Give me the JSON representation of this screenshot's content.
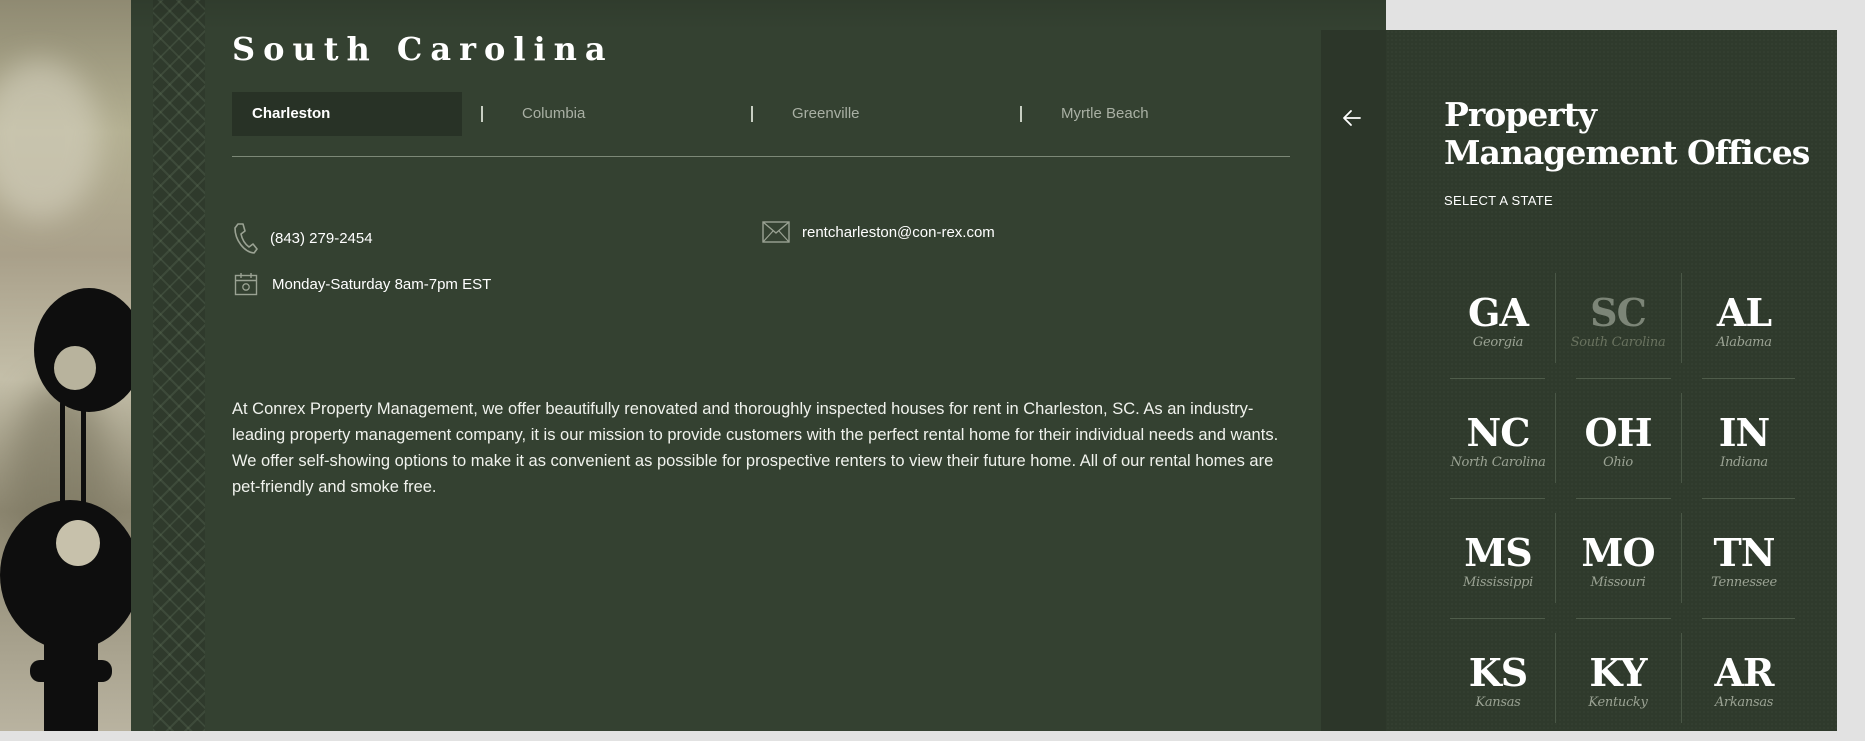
{
  "state": {
    "title": "South Carolina",
    "tabs": [
      {
        "label": "Charleston",
        "active": true
      },
      {
        "label": "Columbia",
        "active": false
      },
      {
        "label": "Greenville",
        "active": false
      },
      {
        "label": "Myrtle Beach",
        "active": false
      }
    ],
    "separator": "|"
  },
  "contact": {
    "phone": "(843) 279-2454",
    "hours": "Monday-Saturday 8am-7pm EST",
    "email": "rentcharleston@con-rex.com"
  },
  "description": "At Conrex Property Management, we offer beautifully renovated and thoroughly inspected houses for rent in Charleston, SC. As an industry-leading property management company, it is our mission to provide customers with the perfect rental home for their individual needs and wants. We offer self-showing options to make it as convenient as possible for prospective renters to view their future home. All of our rental homes are pet-friendly and smoke free.",
  "sidebar": {
    "title_line1": "Property",
    "title_line2": "Management Offices",
    "subtitle": "SELECT A STATE",
    "states": [
      {
        "abbr": "GA",
        "name": "Georgia",
        "selected": false
      },
      {
        "abbr": "SC",
        "name": "South Carolina",
        "selected": true
      },
      {
        "abbr": "AL",
        "name": "Alabama",
        "selected": false
      },
      {
        "abbr": "NC",
        "name": "North Carolina",
        "selected": false
      },
      {
        "abbr": "OH",
        "name": "Ohio",
        "selected": false
      },
      {
        "abbr": "IN",
        "name": "Indiana",
        "selected": false
      },
      {
        "abbr": "MS",
        "name": "Mississippi",
        "selected": false
      },
      {
        "abbr": "MO",
        "name": "Missouri",
        "selected": false
      },
      {
        "abbr": "TN",
        "name": "Tennessee",
        "selected": false
      },
      {
        "abbr": "KS",
        "name": "Kansas",
        "selected": false
      },
      {
        "abbr": "KY",
        "name": "Kentucky",
        "selected": false
      },
      {
        "abbr": "AR",
        "name": "Arkansas",
        "selected": false
      }
    ]
  },
  "icons": {
    "phone": "phone-icon",
    "calendar": "calendar-icon",
    "email": "envelope-icon",
    "back": "arrow-left-icon"
  },
  "colors": {
    "panel": "#344131",
    "sidebar": "#2f3a2c",
    "active_tab": "#283226",
    "muted_text": "#9aa293"
  }
}
